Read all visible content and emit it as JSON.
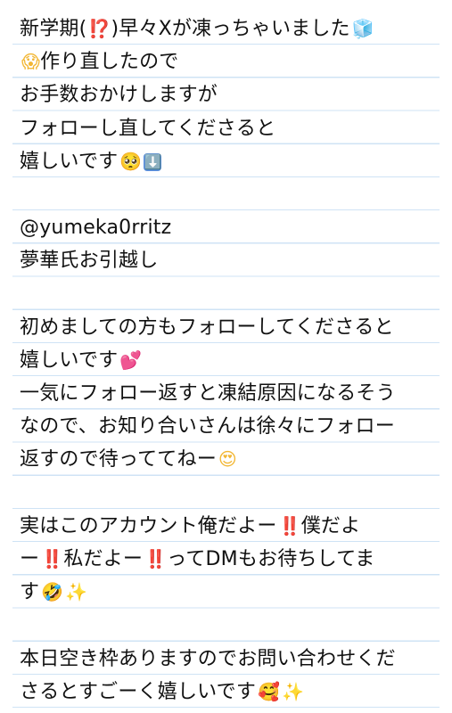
{
  "lines": [
    {
      "text": "新学期(",
      "emoji": "⁉️",
      "rest": ")早々Xが凍っちゃいました",
      "emoji2": "🧊"
    },
    {
      "emoji": "😱",
      "text": "作り直したので"
    },
    {
      "text": "お手数おかけしますが"
    },
    {
      "text": "フォローし直してくださると"
    },
    {
      "text": "嬉しいです",
      "emoji": "🥺",
      "emoji2": "⬇️"
    },
    {
      "text": ""
    },
    {
      "text": "@yumeka0rritz"
    },
    {
      "text": "夢華氏お引越し"
    },
    {
      "text": ""
    },
    {
      "text": "初めましての方もフォローしてくださると"
    },
    {
      "text": "嬉しいです",
      "emoji": "💕"
    },
    {
      "text": "一気にフォロー返すと凍結原因になるそう"
    },
    {
      "text": "なので、お知り合いさんは徐々にフォロー"
    },
    {
      "text": "返すので待っててねー",
      "emoji": "😍"
    },
    {
      "text": ""
    },
    {
      "text": "実はこのアカウント俺だよー",
      "emoji": "‼️",
      "rest": "僕だよ"
    },
    {
      "text": "ー",
      "emoji": "‼️",
      "rest": "私だよー",
      "emoji2": "‼️",
      "rest2": "ってDMもお待ちしてま"
    },
    {
      "text": "す",
      "emoji": "🤣",
      "emoji2": "✨"
    },
    {
      "text": ""
    },
    {
      "text": "本日空き枠ありますのでお問い合わせくだ"
    },
    {
      "text": "さるとすごーく嬉しいです",
      "emoji": "🥰",
      "emoji2": "✨"
    }
  ]
}
